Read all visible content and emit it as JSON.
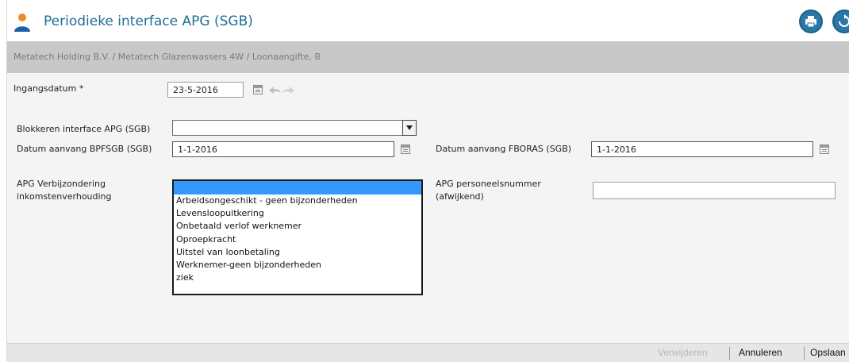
{
  "window": {
    "title": "Periodieke interface APG (SGB)",
    "accent": "#1e6e96",
    "icons": {
      "person": "person-icon",
      "print": "print-icon",
      "refresh": "refresh-icon"
    }
  },
  "breadcrumb": "Metatech Holding B.V. / Metatech Glazenwassers 4W / Loonaangifte, B",
  "form": {
    "ingangsdatum": {
      "label": "Ingangsdatum *",
      "value": "23-5-2016"
    },
    "blokkeren": {
      "label": "Blokkeren interface APG (SGB)",
      "value": ""
    },
    "bpfsgb": {
      "label": "Datum aanvang BPFSGB (SGB)",
      "value": "1-1-2016"
    },
    "fboras": {
      "label": "Datum aanvang FBORAS (SGB)",
      "value": "1-1-2016"
    },
    "verbijzondering": {
      "label_line1": "APG Verbijzondering",
      "label_line2": "inkomstenverhouding",
      "selected": "",
      "options": [
        "Arbeidsongeschikt - geen bijzonderheden",
        "Levensloopuitkering",
        "Onbetaald verlof werknemer",
        "Oproepkracht",
        "Uitstel van loonbetaling",
        "Werknemer-geen bijzonderheden",
        "ziek"
      ]
    },
    "personeelsnummer": {
      "label_line1": "APG personeelsnummer",
      "label_line2": "(afwijkend)",
      "value": ""
    }
  },
  "footer": {
    "verwijderen": "Verwijderen",
    "annuleren": "Annuleren",
    "opslaan": "Opslaan"
  }
}
